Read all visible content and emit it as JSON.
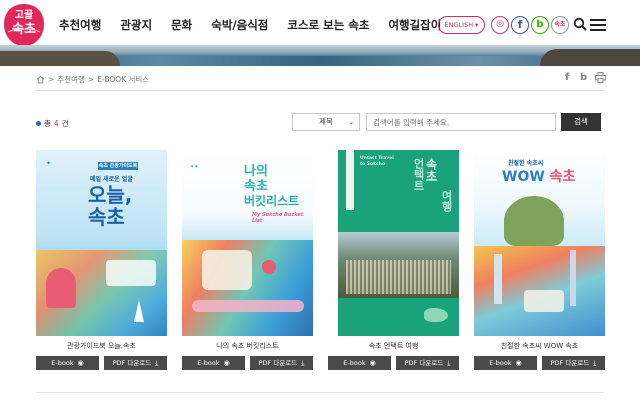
{
  "header": {
    "logo_lines": [
      "고꿀",
      "속초"
    ],
    "nav": [
      "추천여행",
      "관광지",
      "문화",
      "숙박/음식점",
      "코스로 보는 속초",
      "여행길잡이"
    ],
    "language": "ENGLISH ▾",
    "sns": {
      "instagram": "◎",
      "facebook": "f",
      "blog": "b",
      "channel": "속초"
    }
  },
  "breadcrumb": [
    "추천여행",
    "E-BOOK 서비스"
  ],
  "breadcrumb_separator": ">",
  "utility": {
    "facebook": "f",
    "blog": "b"
  },
  "list": {
    "count_prefix": "총",
    "count": "4",
    "count_suffix": "건",
    "select_value": "제목",
    "search_placeholder": "검색어를 입력해 주세요.",
    "search_button": "검색"
  },
  "books": [
    {
      "title": "관광가이드북 오늘,속초",
      "cover_text": [
        "오늘,",
        "속초"
      ],
      "cover_sub": "매일 새로운 얼굴",
      "cover_tag": "속초 관광가이드북"
    },
    {
      "title": "나의 속초 버킷리스트",
      "cover_text": [
        "나의",
        "속초",
        "버킷리스트"
      ],
      "cover_sub": "My Sokcho Bucket List"
    },
    {
      "title": "속초 언택트 여행",
      "cover_text": [
        "속초",
        "언택트",
        "여행"
      ],
      "cover_sub": "Untact Travel to Sokcho"
    },
    {
      "title": "친절한 속초씨 WOW 속초",
      "cover_text": [
        "WOW",
        "속초"
      ],
      "cover_sub": "친절한 속초씨"
    }
  ],
  "buttons": {
    "ebook": "E-book",
    "pdf": "PDF 다운로드"
  },
  "colors": {
    "brand": "#d22a5e",
    "button": "#4a4a4a",
    "accent_dot": "#1a6fd1"
  }
}
